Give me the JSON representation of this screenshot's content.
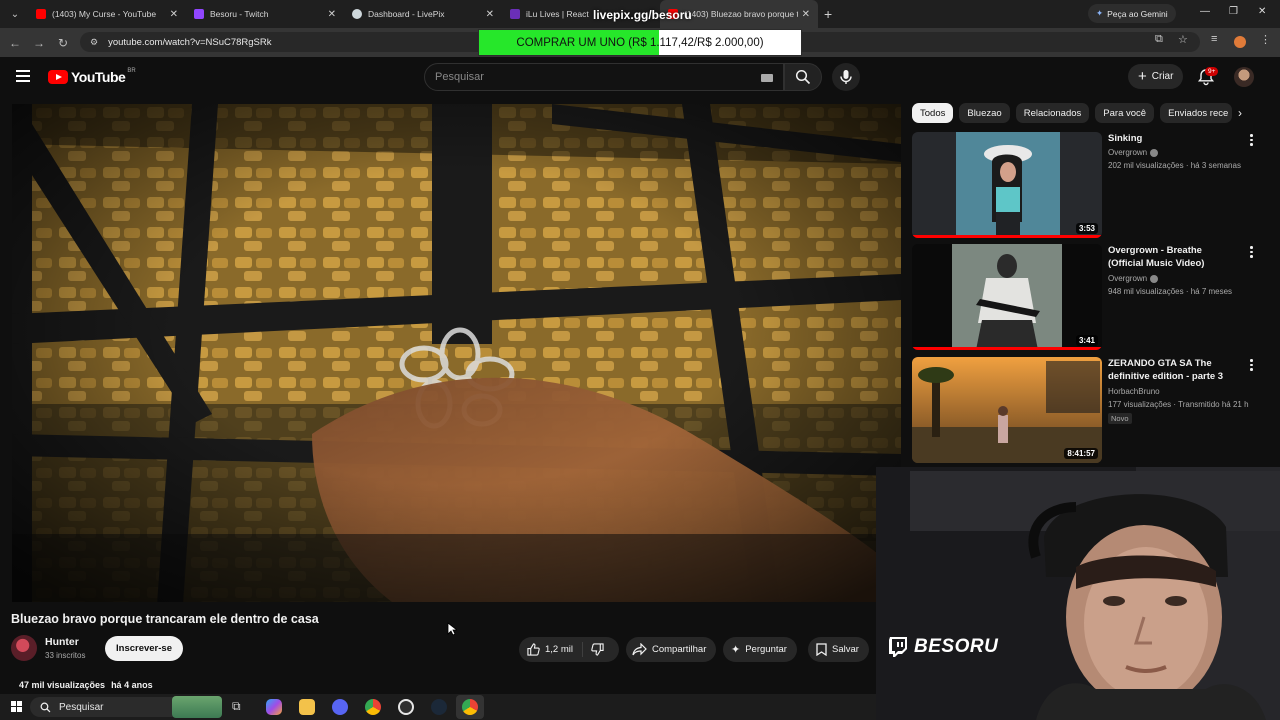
{
  "browser": {
    "tabs": [
      {
        "label": "(1403) My Curse - YouTube",
        "favicon_color": "#ff0000"
      },
      {
        "label": "Besoru - Twitch",
        "favicon_color": "#9146ff"
      },
      {
        "label": "Dashboard - LivePix",
        "favicon_color": "#cfd8dc"
      },
      {
        "label": "iLu Lives | React",
        "favicon_color": "#6a2fb8"
      },
      {
        "label": "(1403) Bluezao bravo porque tr",
        "favicon_color": "#ff0000"
      }
    ],
    "gemini_label": "Peça ao Gemini",
    "url": "youtube.com/watch?v=NSuC78RgSRk"
  },
  "livepix": {
    "overlay_url": "livepix.gg/besoru",
    "goal_text": "COMPRAR UM UNO (R$ 1.117,42/R$ 2.000,00)",
    "progress_fraction": 0.5587,
    "fill_color": "#26e72a"
  },
  "youtube": {
    "logo_text": "YouTube",
    "country_code": "BR",
    "search_placeholder": "Pesquisar",
    "create_label": "Criar",
    "notifications_badge": "9+"
  },
  "video": {
    "title": "Bluezao bravo porque trancaram ele dentro de casa",
    "channel_name": "Hunter",
    "subscribers": "33 inscritos",
    "subscribe_label": "Inscrever-se",
    "likes": "1,2 mil",
    "share_label": "Compartilhar",
    "ask_label": "Perguntar",
    "save_label": "Salvar",
    "views": "47 mil visualizações",
    "age": "há 4 anos"
  },
  "chips": [
    "Todos",
    "Bluezao",
    "Relacionados",
    "Para você",
    "Enviados rece"
  ],
  "recommendations": [
    {
      "title": "Sinking",
      "channel": "Overgrown",
      "verified": true,
      "stats": "202 mil visualizações · há 3 semanas",
      "duration": "3:53",
      "badge": "",
      "watched": true
    },
    {
      "title": "Overgrown - Breathe (Official Music Video)",
      "channel": "Overgrown",
      "verified": true,
      "stats": "948 mil visualizações · há 7 meses",
      "duration": "3:41",
      "badge": "",
      "watched": true
    },
    {
      "title": "ZERANDO GTA SA The definitive edition - parte 3",
      "channel": "HorbachBruno",
      "verified": false,
      "stats": "177 visualizações · Transmitido há 21 h",
      "duration": "8:41:57",
      "badge": "Novo",
      "watched": false
    }
  ],
  "streamer": {
    "name": "BESORU"
  },
  "taskbar": {
    "search_label": "Pesquisar"
  }
}
